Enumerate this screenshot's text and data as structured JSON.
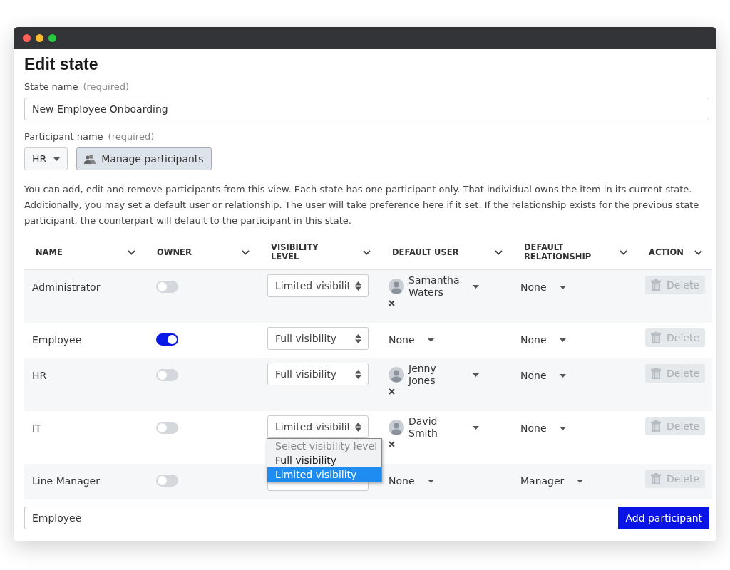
{
  "window": {
    "title": "Edit state"
  },
  "state_name": {
    "label": "State name",
    "hint": "(required)",
    "value": "New Employee Onboarding"
  },
  "participant": {
    "label": "Participant name",
    "hint": "(required)",
    "value": "HR",
    "manage_button": "Manage participants"
  },
  "description": "You can add, edit and remove participants from this view. Each state has one participant only. That individual owns the item in its current state. Additionally, you may set a default user or relationship. The user will take preference here if it set. If the relationship exists for the previous state participant, the counterpart will default to the participant in this state.",
  "table": {
    "columns": [
      "NAME",
      "OWNER",
      "VISIBILITY LEVEL",
      "DEFAULT USER",
      "DEFAULT RELATIONSHIP",
      "ACTION"
    ],
    "rows": [
      {
        "name": "Administrator",
        "owner": false,
        "visibility": "Limited visibilit",
        "default_user": {
          "kind": "user",
          "name": "Samantha Waters"
        },
        "relationship": "None",
        "action": "Delete",
        "disabled": true
      },
      {
        "name": "Employee",
        "owner": true,
        "visibility": "Full visibility",
        "default_user": {
          "kind": "none",
          "name": "None"
        },
        "relationship": "None",
        "action": "Delete",
        "disabled": true
      },
      {
        "name": "HR",
        "owner": false,
        "visibility": "Full visibility",
        "default_user": {
          "kind": "user",
          "name": "Jenny Jones"
        },
        "relationship": "None",
        "action": "Delete",
        "disabled": true
      },
      {
        "name": "IT",
        "owner": false,
        "visibility": "Limited visibilit",
        "default_user": {
          "kind": "user",
          "name": "David Smith"
        },
        "relationship": "None",
        "action": "Delete",
        "disabled": true,
        "open_menu": [
          {
            "label": "Select visibility level",
            "disabled": true,
            "selected": false
          },
          {
            "label": "Full visibility",
            "disabled": false,
            "selected": false
          },
          {
            "label": "Limited visibility",
            "disabled": false,
            "selected": true
          }
        ]
      },
      {
        "name": "Line Manager",
        "owner": false,
        "default_user": {
          "kind": "none",
          "name": "None"
        },
        "relationship": "Manager",
        "action": "Delete",
        "disabled": true
      }
    ]
  },
  "add": {
    "value": "Employee",
    "button": "Add participant"
  }
}
